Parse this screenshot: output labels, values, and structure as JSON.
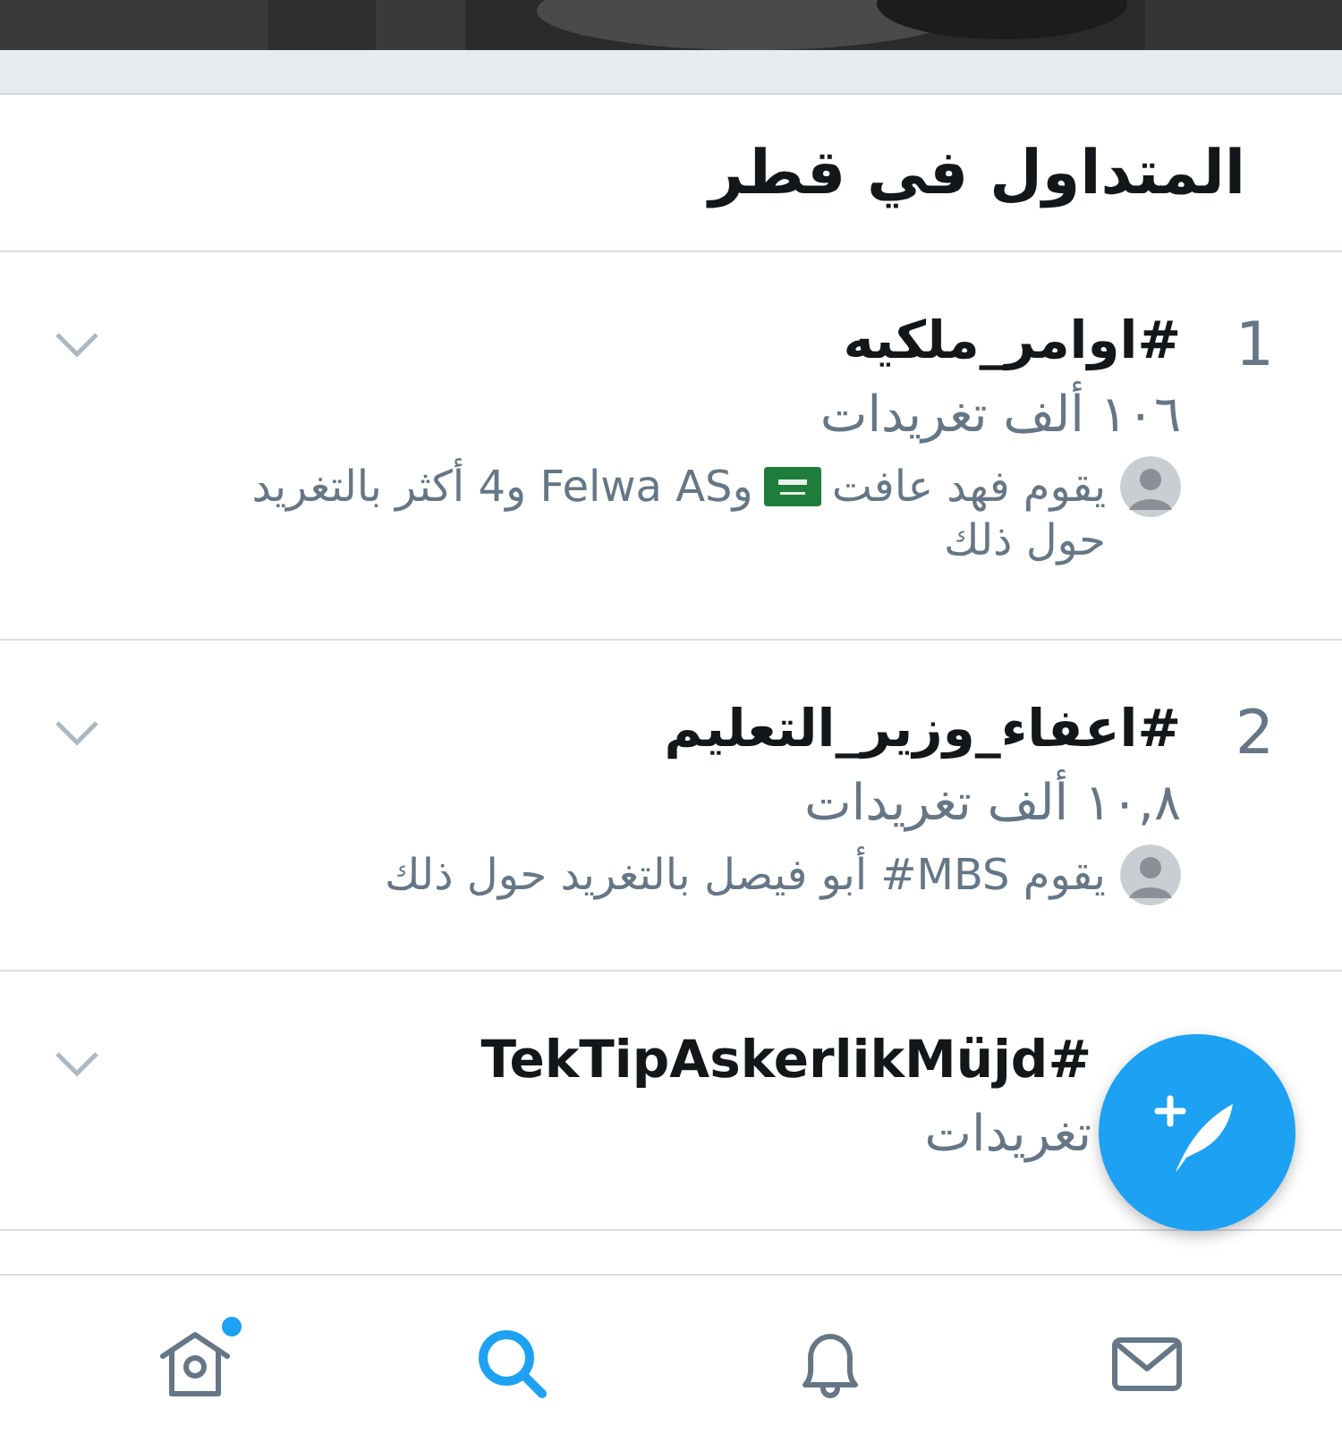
{
  "header": {
    "title": "المتداول في قطر"
  },
  "trends": [
    {
      "rank": "1",
      "hashtag": "#اوامر_ملكيه",
      "count": "١٠٦ ألف تغريدات",
      "context": [
        [
          {
            "kind": "text",
            "text": "يقوم فهد عافت"
          },
          {
            "kind": "flag"
          },
          {
            "kind": "text",
            "text": "وFelwa AS و4 أكثر بالتغريد"
          }
        ],
        [
          {
            "kind": "text",
            "text": "حول ذلك"
          }
        ]
      ]
    },
    {
      "rank": "2",
      "hashtag": "#اعفاء_وزير_التعليم",
      "count": "١٠,٨ ألف تغريدات",
      "context": [
        [
          {
            "kind": "text",
            "text": "يقوم MBS# أبو فيصل بالتغريد حول ذلك"
          }
        ]
      ]
    },
    {
      "hashtag": "#TekTipAskerlikMüjd",
      "count": "تغريدات"
    }
  ],
  "nav": [
    {
      "kind": "home",
      "selected": false,
      "dot": true
    },
    {
      "kind": "search",
      "selected": true,
      "dot": false
    },
    {
      "kind": "notifications",
      "selected": false,
      "dot": false
    },
    {
      "kind": "messages",
      "selected": false,
      "dot": false
    }
  ]
}
